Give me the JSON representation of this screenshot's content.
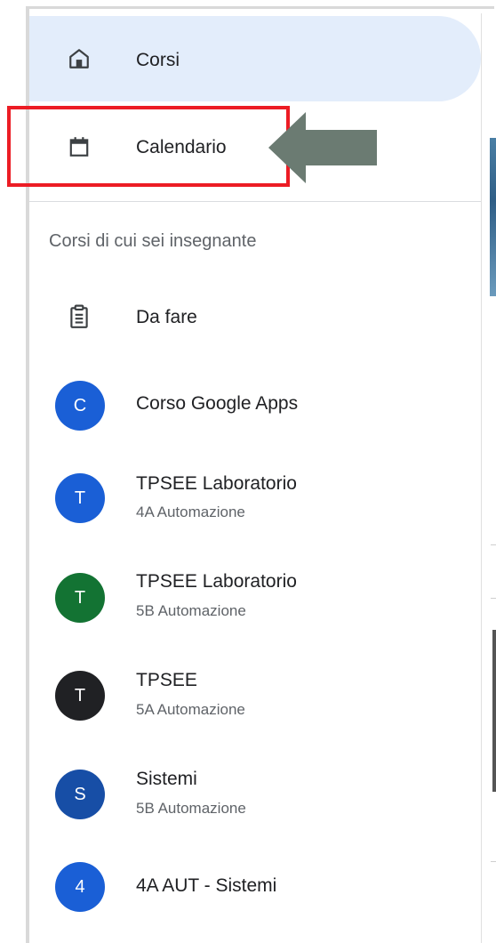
{
  "nav": {
    "corsi_label": "Corsi",
    "calendario_label": "Calendario"
  },
  "section": {
    "title": "Corsi di cui sei insegnante"
  },
  "todo": {
    "label": "Da fare"
  },
  "courses": [
    {
      "initial": "C",
      "name": "Corso Google Apps",
      "subtitle": "",
      "color": "#1a5fd6"
    },
    {
      "initial": "T",
      "name": "TPSEE Laboratorio",
      "subtitle": "4A Automazione",
      "color": "#1a5fd6"
    },
    {
      "initial": "T",
      "name": "TPSEE Laboratorio",
      "subtitle": "5B Automazione",
      "color": "#137333"
    },
    {
      "initial": "T",
      "name": "TPSEE",
      "subtitle": "5A Automazione",
      "color": "#202124"
    },
    {
      "initial": "S",
      "name": "Sistemi",
      "subtitle": "5B Automazione",
      "color": "#174ea6"
    },
    {
      "initial": "4",
      "name": "4A AUT - Sistemi",
      "subtitle": "",
      "color": "#1a5fd6"
    }
  ],
  "icons": {
    "corsi": "home-icon",
    "calendario": "calendar-icon",
    "todo": "clipboard-icon"
  },
  "annotation": {
    "box_color": "#ec1c24",
    "arrow_color": "#6b7b72"
  },
  "colors": {
    "active_bg": "#e3edfb"
  }
}
